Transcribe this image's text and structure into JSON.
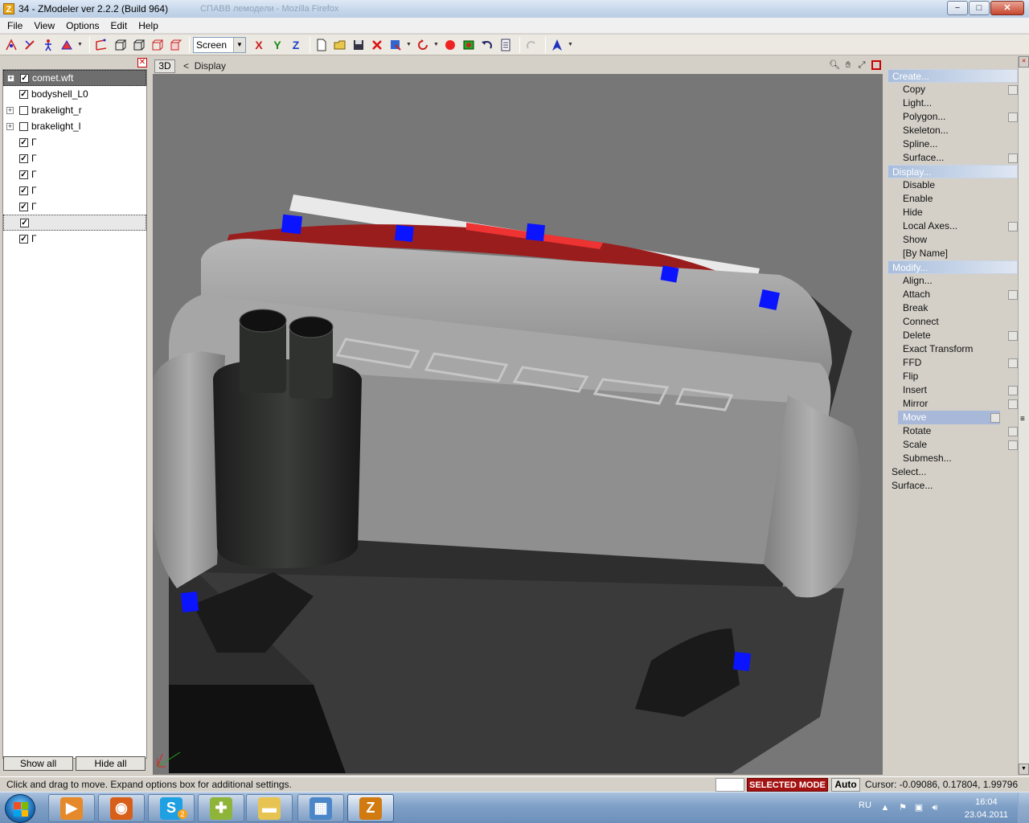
{
  "window": {
    "title": "34 - ZModeler ver 2.2.2 (Build 964)",
    "background_title": "СПАВВ лемодели - Mozilla Firefox",
    "app_icon_letter": "Z",
    "minimize": "−",
    "maximize": "□",
    "close": "✕"
  },
  "menu": {
    "items": [
      "File",
      "View",
      "Options",
      "Edit",
      "Help"
    ]
  },
  "toolbar": {
    "select_value": "Screen",
    "axis_x": "X",
    "axis_y": "Y",
    "axis_z": "Z"
  },
  "tree": {
    "rows": [
      {
        "label": "comet.wft",
        "expandable": true,
        "checked": true
      },
      {
        "label": "bodyshell_L0",
        "expandable": false,
        "checked": true
      },
      {
        "label": "brakelight_r",
        "expandable": true,
        "checked": false
      },
      {
        "label": "brakelight_l",
        "expandable": true,
        "checked": false
      },
      {
        "label": "Г",
        "expandable": false,
        "checked": true
      },
      {
        "label": "Г",
        "expandable": false,
        "checked": true
      },
      {
        "label": "Г",
        "expandable": false,
        "checked": true
      },
      {
        "label": "Г",
        "expandable": false,
        "checked": true
      },
      {
        "label": "Г",
        "expandable": false,
        "checked": true
      },
      {
        "label": "",
        "expandable": false,
        "checked": true
      },
      {
        "label": "Г",
        "expandable": false,
        "checked": true
      }
    ],
    "expand_glyph": "+",
    "check_glyph": "✓",
    "show_all": "Show all",
    "hide_all": "Hide all"
  },
  "viewport": {
    "mode": "3D",
    "breadcrumb_arrow": "<",
    "breadcrumb": "Display",
    "icons": [
      "zoom-icon",
      "pan-hand-icon",
      "maximize-icon",
      "close-icon"
    ]
  },
  "commands": {
    "create_header": "Create...",
    "create_items": [
      {
        "label": "Copy",
        "opt": true
      },
      {
        "label": "Light...",
        "opt": false
      },
      {
        "label": "Polygon...",
        "opt": true
      },
      {
        "label": "Skeleton...",
        "opt": false
      },
      {
        "label": "Spline...",
        "opt": false
      },
      {
        "label": "Surface...",
        "opt": true
      }
    ],
    "display_header": "Display...",
    "display_items": [
      {
        "label": "Disable",
        "opt": false
      },
      {
        "label": "Enable",
        "opt": false
      },
      {
        "label": "Hide",
        "opt": false
      },
      {
        "label": "Local Axes...",
        "opt": true
      },
      {
        "label": "Show",
        "opt": false
      },
      {
        "label": "[By Name]",
        "opt": false
      }
    ],
    "modify_header": "Modify...",
    "modify_items": [
      {
        "label": "Align...",
        "opt": false
      },
      {
        "label": "Attach",
        "opt": true
      },
      {
        "label": "Break",
        "opt": false
      },
      {
        "label": "Connect",
        "opt": false
      },
      {
        "label": "Delete",
        "opt": true
      },
      {
        "label": "Exact Transform",
        "opt": false
      },
      {
        "label": "FFD",
        "opt": true
      },
      {
        "label": "Flip",
        "opt": false
      },
      {
        "label": "Insert",
        "opt": true
      },
      {
        "label": "Mirror",
        "opt": true
      },
      {
        "label": "Move",
        "opt": true,
        "active": true
      },
      {
        "label": "Rotate",
        "opt": true
      },
      {
        "label": "Scale",
        "opt": true
      },
      {
        "label": "Submesh...",
        "opt": false
      }
    ],
    "select_item": "Select...",
    "surface_item": "Surface..."
  },
  "status": {
    "message": "Click and drag to move. Expand options box for additional settings.",
    "mode": "SELECTED MODE",
    "auto": "Auto",
    "cursor": "Cursor: -0.09086, 0.17804, 1.99796"
  },
  "taskbar": {
    "apps": [
      {
        "name": "media-player",
        "icon": "media-player-icon",
        "color": "#e6892a"
      },
      {
        "name": "firefox",
        "icon": "firefox-icon",
        "color": "#d85f1a"
      },
      {
        "name": "skype",
        "icon": "skype-icon",
        "color": "#1fa0e3",
        "badge": "2"
      },
      {
        "name": "utility",
        "icon": "puzzle-icon",
        "color": "#8fb43a"
      },
      {
        "name": "explorer",
        "icon": "folder-icon",
        "color": "#e7c452"
      },
      {
        "name": "image-viewer",
        "icon": "picture-icon",
        "color": "#4a86c8"
      },
      {
        "name": "zmodeler",
        "icon": "zmodeler-icon",
        "color": "#d07a10",
        "letter": "Z",
        "active": true
      }
    ],
    "lang": "RU",
    "time": "16:04",
    "date": "23.04.2011"
  },
  "colors": {
    "viewport_bg": "#777777",
    "selection_vertex": "#0a14ff",
    "status_mode_bg": "#a51212",
    "category_header": "#a8bddc"
  }
}
